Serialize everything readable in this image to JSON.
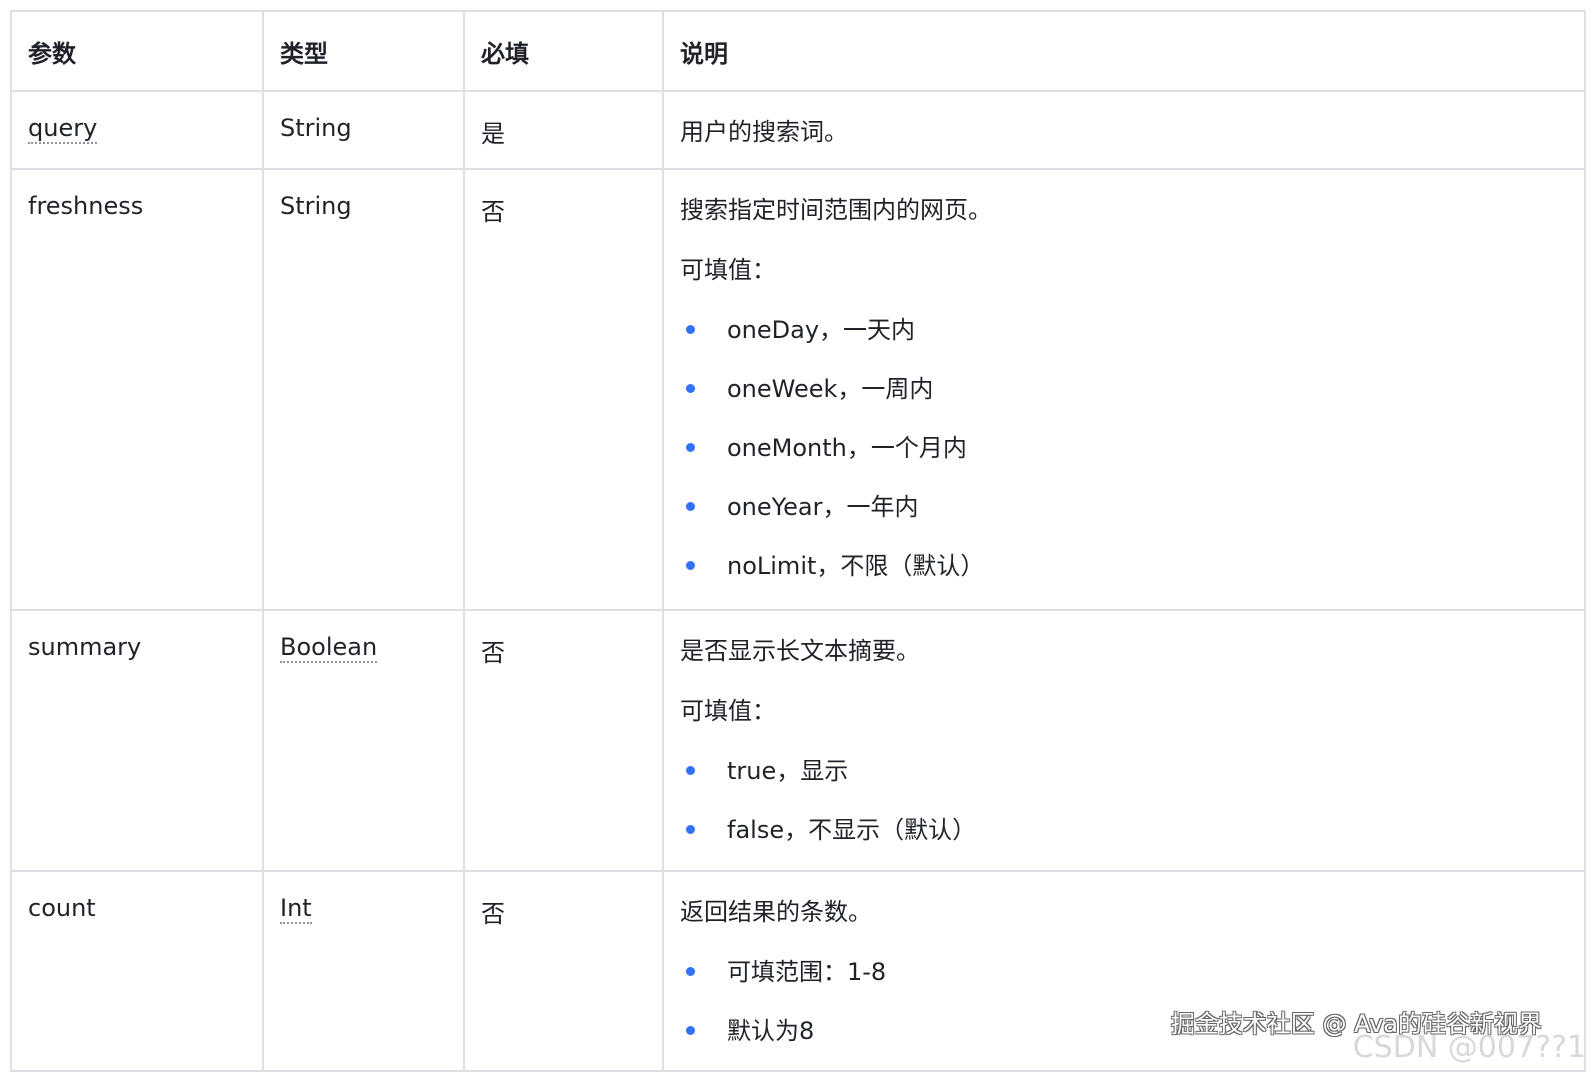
{
  "headers": [
    "参数",
    "类型",
    "必填",
    "说明"
  ],
  "rows": [
    {
      "param": "query",
      "type": "String",
      "required": "是",
      "desc": [
        "用户的搜索词。"
      ],
      "items": []
    },
    {
      "param": "freshness",
      "type": "String",
      "required": "否",
      "desc": [
        "搜索指定时间范围内的网页。",
        "可填值："
      ],
      "items": [
        "oneDay，一天内",
        "oneWeek，一周内",
        "oneMonth，一个月内",
        "oneYear，一年内",
        "noLimit，不限（默认）"
      ]
    },
    {
      "param": "summary",
      "type": "Boolean",
      "required": "否",
      "desc": [
        "是否显示长文本摘要。",
        "可填值："
      ],
      "items": [
        "true，显示",
        "false，不显示（默认）"
      ]
    },
    {
      "param": "count",
      "type": "Int",
      "required": "否",
      "desc": [
        "返回结果的条数。"
      ],
      "items": [
        "可填范围：1-8",
        "默认为8"
      ]
    }
  ],
  "watermark": "掘金技术社区 @ Ava的硅谷新视界",
  "watermark2": "CSDN @007??1",
  "colors": {
    "bullet": "#3370ff",
    "border": "#dee0e3"
  }
}
